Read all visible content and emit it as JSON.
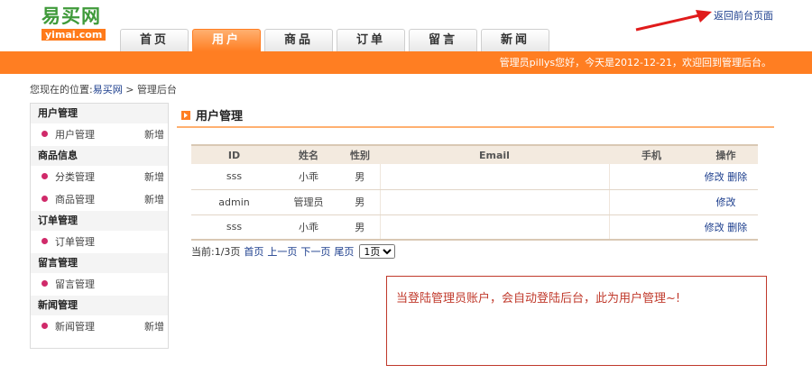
{
  "logo": {
    "cn": "易买网",
    "en": "yimai.com"
  },
  "nav": {
    "tabs": [
      "首页",
      "用户",
      "商品",
      "订单",
      "留言",
      "新闻"
    ],
    "active": 1
  },
  "top_link": "返回前台页面",
  "welcome": "管理员pillys您好，今天是2012-12-21，欢迎回到管理后台。",
  "breadcrumb": {
    "prefix": "您现在的位置:",
    "home": "易买网",
    "sep": " > ",
    "current": "管理后台"
  },
  "sidebar": {
    "sections": [
      {
        "title": "用户管理",
        "items": [
          {
            "label": "用户管理",
            "add": "新增"
          }
        ]
      },
      {
        "title": "商品信息",
        "items": [
          {
            "label": "分类管理",
            "add": "新增"
          },
          {
            "label": "商品管理",
            "add": "新增"
          }
        ]
      },
      {
        "title": "订单管理",
        "items": [
          {
            "label": "订单管理",
            "add": ""
          }
        ]
      },
      {
        "title": "留言管理",
        "items": [
          {
            "label": "留言管理",
            "add": ""
          }
        ]
      },
      {
        "title": "新闻管理",
        "items": [
          {
            "label": "新闻管理",
            "add": "新增"
          }
        ]
      }
    ]
  },
  "main": {
    "title": "用户管理",
    "table": {
      "headers": [
        "ID",
        "姓名",
        "性别",
        "Email",
        "手机",
        "操作"
      ],
      "rows": [
        {
          "id": "sss",
          "name": "小乖",
          "gender": "男",
          "email": "",
          "phone": "",
          "ops": [
            "修改",
            "删除"
          ]
        },
        {
          "id": "admin",
          "name": "管理员",
          "gender": "男",
          "email": "",
          "phone": "",
          "ops": [
            "修改"
          ]
        },
        {
          "id": "sss",
          "name": "小乖",
          "gender": "男",
          "email": "",
          "phone": "",
          "ops": [
            "修改",
            "删除"
          ]
        }
      ]
    },
    "pager": {
      "info": "当前:1/3页",
      "first": "首页",
      "prev": "上一页",
      "next": "下一页",
      "last": "尾页",
      "select_value": "1页"
    }
  },
  "note": "当登陆管理员账户，会自动登陆后台，此为用户管理~!",
  "colors": {
    "accent": "#ff7e22",
    "link": "#1a3c8c",
    "note": "#c0392b"
  }
}
